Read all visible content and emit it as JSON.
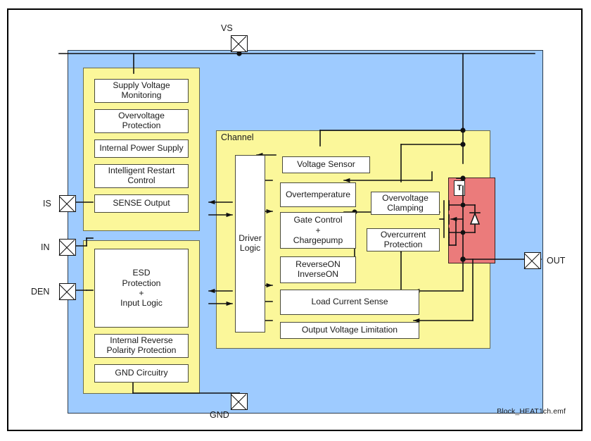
{
  "caption": "Block_HEAT1ch.emf",
  "regions": {
    "channel_label": "Channel"
  },
  "pins": [
    {
      "name": "VS",
      "label": "VS"
    },
    {
      "name": "IS",
      "label": "IS"
    },
    {
      "name": "IN",
      "label": "IN"
    },
    {
      "name": "DEN",
      "label": "DEN"
    },
    {
      "name": "GND",
      "label": "GND"
    },
    {
      "name": "OUT",
      "label": "OUT"
    }
  ],
  "supply_group": {
    "blocks": [
      {
        "label": "Supply Voltage\nMonitoring"
      },
      {
        "label": "Overvoltage\nProtection"
      },
      {
        "label": "Internal Power Supply"
      },
      {
        "label": "Intelligent Restart\nControl"
      },
      {
        "label": "SENSE Output"
      }
    ]
  },
  "input_group": {
    "blocks": [
      {
        "label": "ESD\nProtection\n+\nInput Logic"
      },
      {
        "label": "Internal Reverse\nPolarity Protection"
      },
      {
        "label": "GND Circuitry"
      }
    ]
  },
  "channel_group": {
    "blocks": [
      {
        "label": "Driver\nLogic"
      },
      {
        "label": "Voltage Sensor"
      },
      {
        "label": "Overtemperature"
      },
      {
        "label": "Gate Control\n+\nChargepump"
      },
      {
        "label": "ReverseON\nInverseON"
      },
      {
        "label": "Load Current Sense"
      },
      {
        "label": "Output Voltage Limitation"
      },
      {
        "label": "Overvoltage\nClamping"
      },
      {
        "label": "Overcurrent\nProtection"
      }
    ]
  },
  "power_stage": {
    "temp_sensor_label": "T",
    "device": "n-channel-mosfet-with-body-diode"
  },
  "colors": {
    "chip_fill": "#9ecbff",
    "group_fill": "#fbf79a",
    "block_fill": "#ffffff",
    "power_stage_fill": "#eb7b7b",
    "wire": "#111111"
  }
}
